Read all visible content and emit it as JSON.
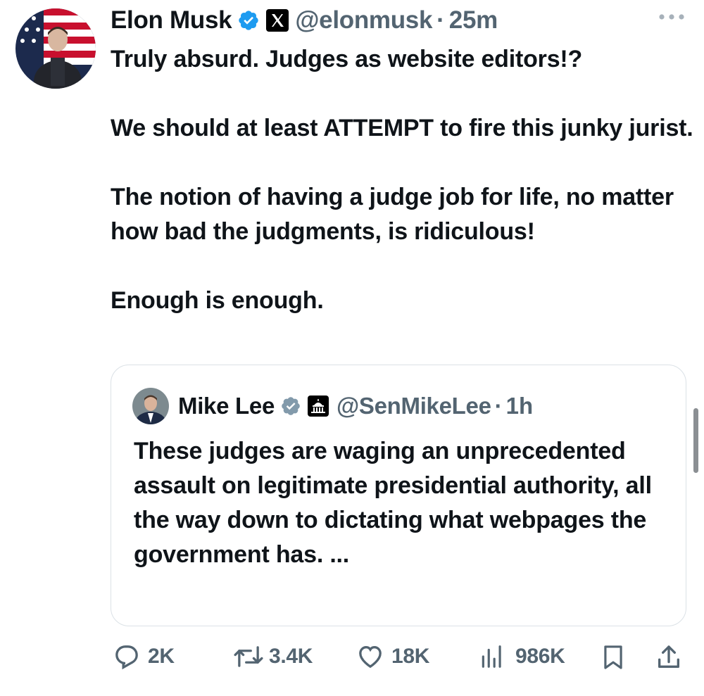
{
  "tweet": {
    "author_name": "Elon Musk",
    "handle": "@elonmusk",
    "separator": "·",
    "time": "25m",
    "text_paragraphs": [
      "Truly absurd. Judges as website editors!?",
      "We should at least ATTEMPT to fire this junky jurist.",
      "The notion of having a judge job for life, no matter how bad the judgments, is ridiculous!",
      "Enough is enough."
    ],
    "more_icon": "more-horizontal-icon",
    "verified_badge": "verified-badge-icon",
    "affiliation_badge": "x-logo-icon"
  },
  "quoted_tweet": {
    "author_name": "Mike Lee",
    "handle": "@SenMikeLee",
    "separator": "·",
    "time": "1h",
    "text": "These judges are waging an unprecedented assault on legitimate presidential authority, all the way down to dictating what webpages the government has. ...",
    "verified_badge": "gray-verified-badge-icon",
    "affiliation_badge": "capitol-building-icon"
  },
  "actions": {
    "replies": "2K",
    "reposts": "3.4K",
    "likes": "18K",
    "views": "986K"
  },
  "colors": {
    "text": "#0f1419",
    "secondary_text": "#536471",
    "verified_blue": "#1d9bf0",
    "gray_badge": "#829aab",
    "border": "#dbe1e6"
  }
}
